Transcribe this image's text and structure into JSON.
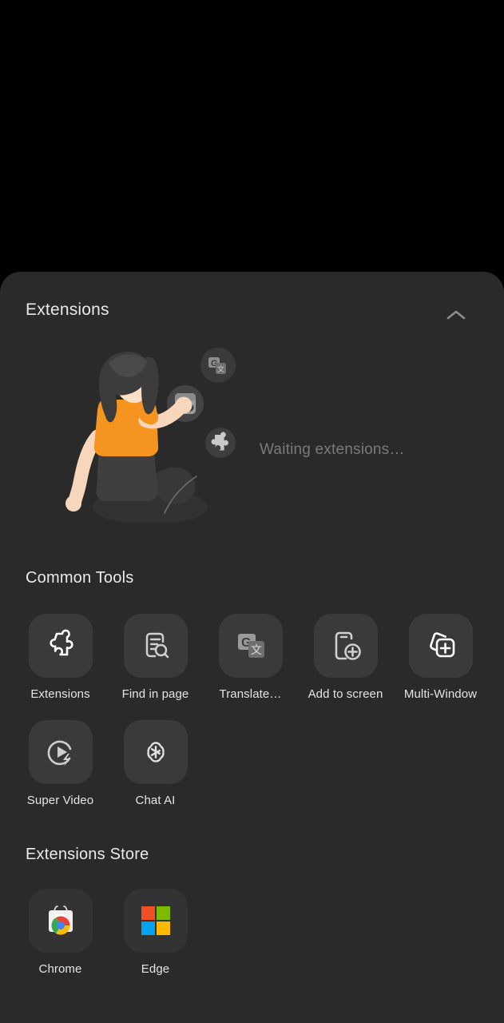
{
  "theme": {
    "page_background": "#000000",
    "sheet_background": "#2a2a2a",
    "tile_background": "#3a3a3a",
    "primary_text": "#e8e8e8",
    "muted_text": "#7a7a7a",
    "accent_orange": "#f5951f"
  },
  "extensions_panel": {
    "title": "Extensions",
    "collapse_icon": "chevron-up-icon",
    "status_text": "Waiting extensions…",
    "illustration": {
      "name": "person-with-extension-icons-illustration",
      "floating_badges": [
        "translate-icon",
        "reader-glasses-icon",
        "puzzle-piece-icon"
      ]
    }
  },
  "common_tools": {
    "title": "Common Tools",
    "items": [
      {
        "label": "Extensions",
        "icon": "puzzle-piece-icon"
      },
      {
        "label": "Find in page",
        "icon": "document-search-icon"
      },
      {
        "label": "Translate…",
        "icon": "google-translate-icon"
      },
      {
        "label": "Add to screen",
        "icon": "add-to-home-screen-icon"
      },
      {
        "label": "Multi-Window",
        "icon": "multi-window-add-icon"
      },
      {
        "label": "Super Video",
        "icon": "super-video-play-icon"
      },
      {
        "label": "Chat AI",
        "icon": "openai-logo-icon"
      }
    ]
  },
  "extensions_store": {
    "title": "Extensions Store",
    "items": [
      {
        "label": "Chrome",
        "icon": "chrome-web-store-icon"
      },
      {
        "label": "Edge",
        "icon": "microsoft-logo-icon"
      }
    ]
  }
}
